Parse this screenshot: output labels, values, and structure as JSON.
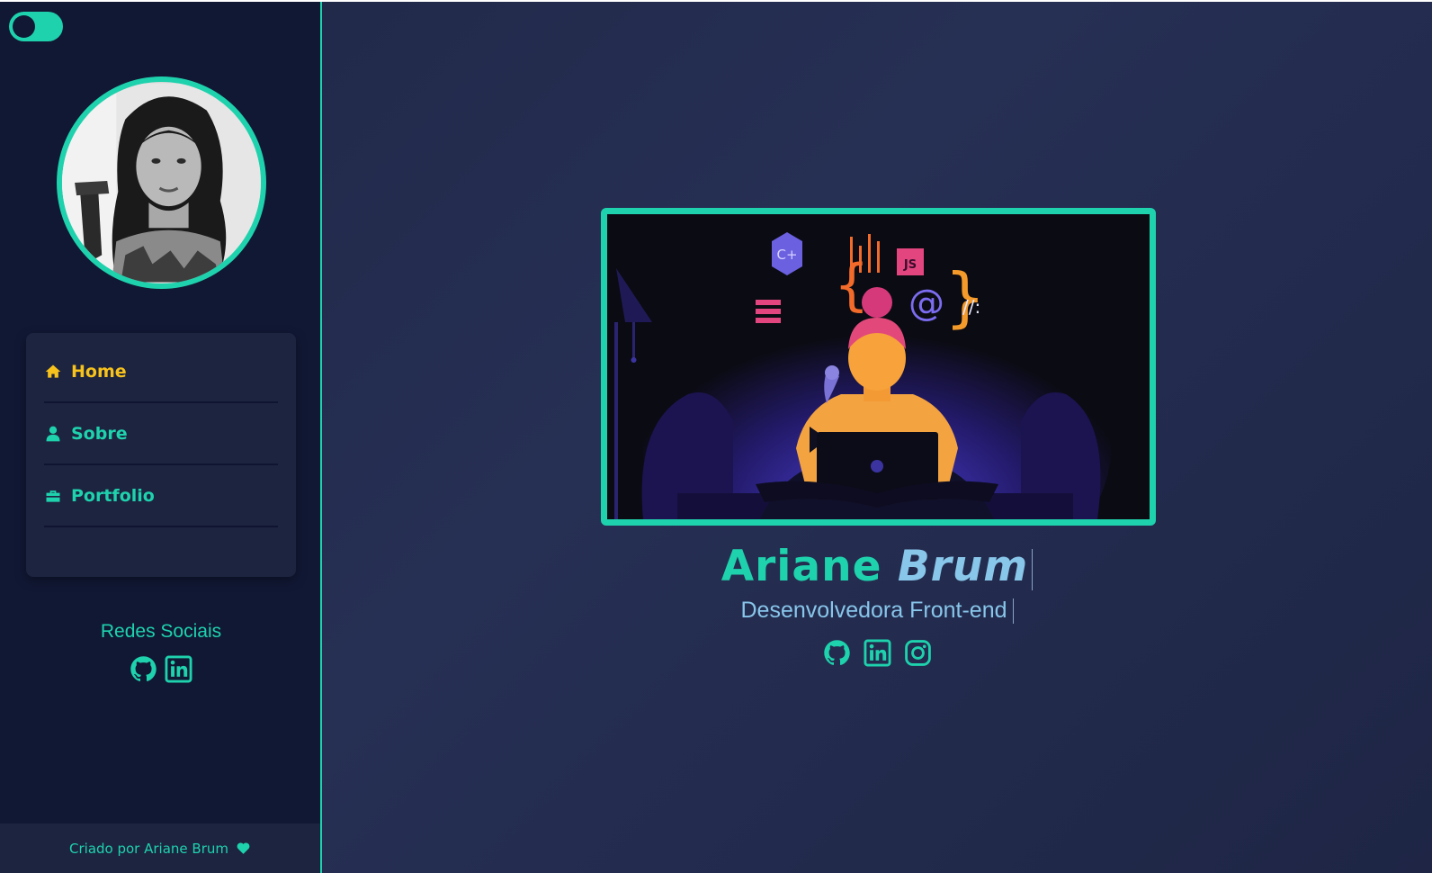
{
  "sidebar": {
    "theme_toggle": {
      "state": "dark"
    },
    "nav": {
      "items": [
        {
          "label": "Home",
          "icon": "home-icon",
          "active": true
        },
        {
          "label": "Sobre",
          "icon": "user-icon",
          "active": false
        },
        {
          "label": "Portfolio",
          "icon": "briefcase-icon",
          "active": false
        }
      ]
    },
    "social_title": "Redes Sociais",
    "social_links": [
      "github-icon",
      "linkedin-icon"
    ],
    "footer_text": "Criado por Ariane Brum"
  },
  "main": {
    "first_name": "Ariane",
    "last_name": "Brum",
    "role": "Desenvolvedora Front-end",
    "social_links": [
      "github-icon",
      "linkedin-icon",
      "instagram-icon"
    ],
    "illustration_text": {
      "cplus": "C+",
      "js": "JS",
      "at": "@",
      "slashes": "//:"
    }
  },
  "colors": {
    "accent": "#1ed2ad",
    "active_nav": "#f7c21b",
    "secondary_text": "#88c6ea",
    "sidebar_bg": "#111834",
    "card_bg": "#1d2440"
  }
}
